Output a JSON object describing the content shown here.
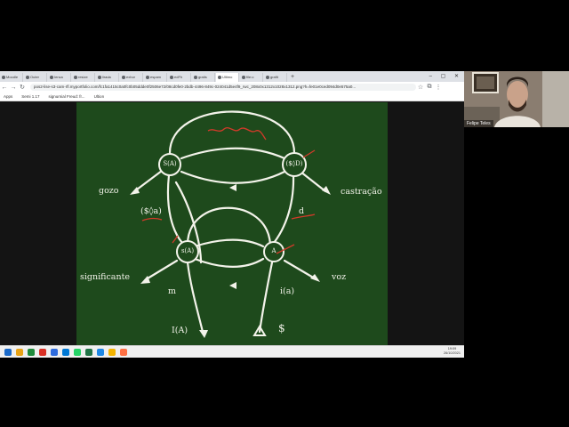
{
  "browser": {
    "tabs": [
      "Moodle",
      "Outer",
      "Ienca",
      "resize",
      "lirada",
      "exhor",
      "espam",
      "edFh",
      "gratis",
      "Ultimo",
      "file:o",
      "grafit"
    ],
    "new_tab_glyph": "+",
    "window_controls": "– ▢ ✕",
    "url": "pos2-lise-s3-cam-rfl.myportfolio.com/fc1fa1415c0a0fc0b05ddde0f2506e72/08cd0fe0-2bdb-4496-849c-024041d5e4f9_rwc_208x0x1312x1028x1312.png?h=fe01e0ced094d0e575a0...",
    "bookmarks": [
      "Apps",
      "Semi 1.17",
      "signurnial Freud: fr...",
      "Ultion"
    ]
  },
  "graph": {
    "nodes": {
      "s_a_top": "S(A)",
      "s_diamond_d": "($◊D)",
      "s_a_mid": "s(A)",
      "a_node": "A"
    },
    "labels": {
      "gozo": "gozo",
      "castracao": "castração",
      "s_diamond_a": "($◊a)",
      "d": "d",
      "significante": "significante",
      "voz": "voz",
      "m": "m",
      "i_a": "i(a)",
      "I_A": "I(A)",
      "S_barred": "$"
    }
  },
  "webcam": {
    "name": "Felipe Teles"
  },
  "taskbar": {
    "time": "19:09",
    "date": "26/10/2021",
    "icon_colors": [
      "#1b6ac9",
      "#e8a317",
      "#1f8a3b",
      "#d93025",
      "#2f6cde",
      "#0078d4",
      "#25d366",
      "#217346",
      "#1e88e5",
      "#f4b400",
      "#ff7043"
    ]
  }
}
